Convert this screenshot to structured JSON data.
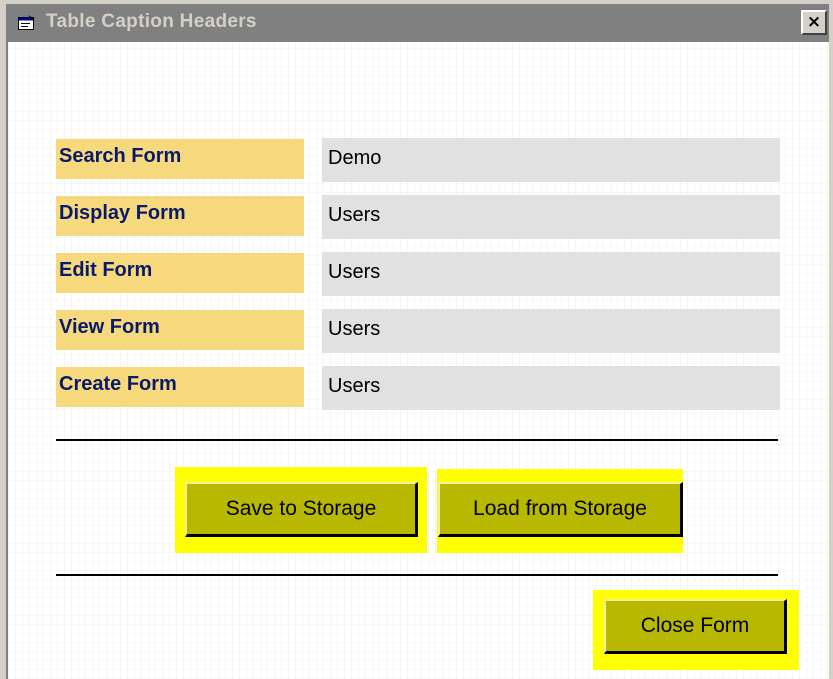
{
  "window": {
    "title": "Table Caption Headers",
    "close_label": "×"
  },
  "form": {
    "rows": [
      {
        "label": "Search Form",
        "value": "Demo"
      },
      {
        "label": "Display Form",
        "value": "Users"
      },
      {
        "label": "Edit Form",
        "value": "Users"
      },
      {
        "label": "View Form",
        "value": "Users"
      },
      {
        "label": "Create Form",
        "value": "Users"
      }
    ]
  },
  "buttons": {
    "save_label": "Save to Storage",
    "load_label": "Load from Storage",
    "close_label": "Close Form"
  },
  "colors": {
    "label_background": "#f5d97c",
    "label_text": "#0a1a6a",
    "field_background": "#e1e1e1",
    "button_face": "#b8b800",
    "button_highlight": "#ffff00",
    "titlebar_inactive": "#808080"
  },
  "icons": {
    "title_icon": "form-window-icon"
  }
}
